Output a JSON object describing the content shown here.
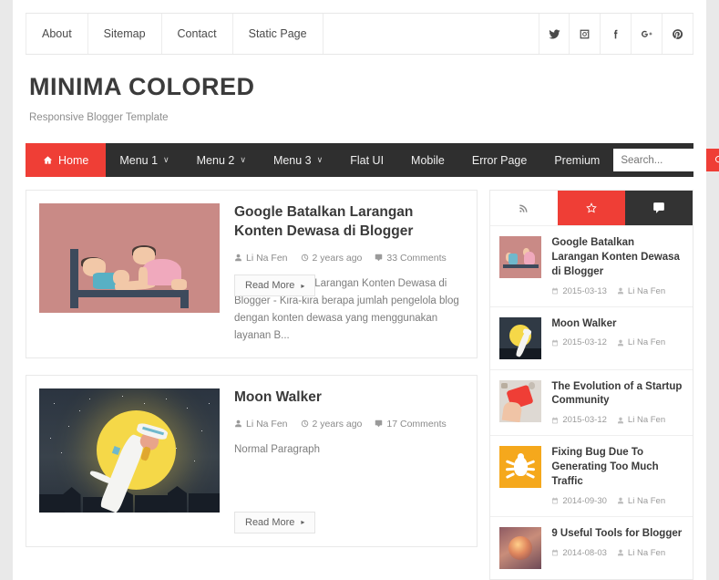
{
  "topbar": {
    "nav": [
      {
        "label": "About"
      },
      {
        "label": "Sitemap"
      },
      {
        "label": "Contact"
      },
      {
        "label": "Static Page"
      }
    ],
    "social": [
      {
        "name": "twitter-icon"
      },
      {
        "name": "instagram-icon"
      },
      {
        "name": "facebook-icon"
      },
      {
        "name": "googleplus-icon"
      },
      {
        "name": "pinterest-icon"
      }
    ]
  },
  "branding": {
    "title": "MINIMA COLORED",
    "tagline": "Responsive Blogger Template"
  },
  "mainnav": {
    "items": [
      {
        "label": "Home",
        "active": true,
        "caret": false,
        "icon": "home-icon"
      },
      {
        "label": "Menu 1",
        "active": false,
        "caret": true
      },
      {
        "label": "Menu 2",
        "active": false,
        "caret": true
      },
      {
        "label": "Menu 3",
        "active": false,
        "caret": true
      },
      {
        "label": "Flat UI",
        "active": false,
        "caret": false
      },
      {
        "label": "Mobile",
        "active": false,
        "caret": false
      },
      {
        "label": "Error Page",
        "active": false,
        "caret": false
      },
      {
        "label": "Premium",
        "active": false,
        "caret": false
      }
    ],
    "caret_glyph": "∨",
    "search": {
      "placeholder": "Search...",
      "value": "",
      "button_icon": "search-icon"
    },
    "accent_color": "#ef3e36",
    "bar_color": "#2f2f2f"
  },
  "posts": [
    {
      "title": "Google Batalkan Larangan Konten Dewasa di Blogger",
      "author": "Li Na Fen",
      "date": "2 years ago",
      "comments": "33 Comments",
      "excerpt": "Google Batalkan Larangan Konten Dewasa di Blogger - Kira-kira berapa jumlah pengelola blog dengan konten dewasa yang menggunakan layanan B...",
      "read_more": "Read More",
      "read_more_arrow": "▸",
      "thumb_name": "post-thumbnail-bedroom-illustration"
    },
    {
      "title": "Moon Walker",
      "author": "Li Na Fen",
      "date": "2 years ago",
      "comments": "17 Comments",
      "excerpt": "Normal Paragraph",
      "read_more": "Read More",
      "read_more_arrow": "▸",
      "thumb_name": "post-thumbnail-moonwalker-illustration"
    }
  ],
  "sidebar": {
    "tabs": [
      {
        "name": "rss-icon",
        "state": "default"
      },
      {
        "name": "star-icon",
        "state": "active"
      },
      {
        "name": "comment-icon",
        "state": "dark"
      }
    ],
    "items": [
      {
        "title": "Google Batalkan Larangan Konten Dewasa di Blogger",
        "date": "2015-03-13",
        "author": "Li Na Fen",
        "thumb": "bed"
      },
      {
        "title": "Moon Walker",
        "date": "2015-03-12",
        "author": "Li Na Fen",
        "thumb": "moon"
      },
      {
        "title": "The Evolution of a Startup Community",
        "date": "2015-03-12",
        "author": "Li Na Fen",
        "thumb": "phone"
      },
      {
        "title": "Fixing Bug Due To Generating Too Much Traffic",
        "date": "2014-09-30",
        "author": "Li Na Fen",
        "thumb": "bug"
      },
      {
        "title": "9 Useful Tools for Blogger",
        "date": "2014-08-03",
        "author": "Li Na Fen",
        "thumb": "lamp"
      }
    ]
  }
}
